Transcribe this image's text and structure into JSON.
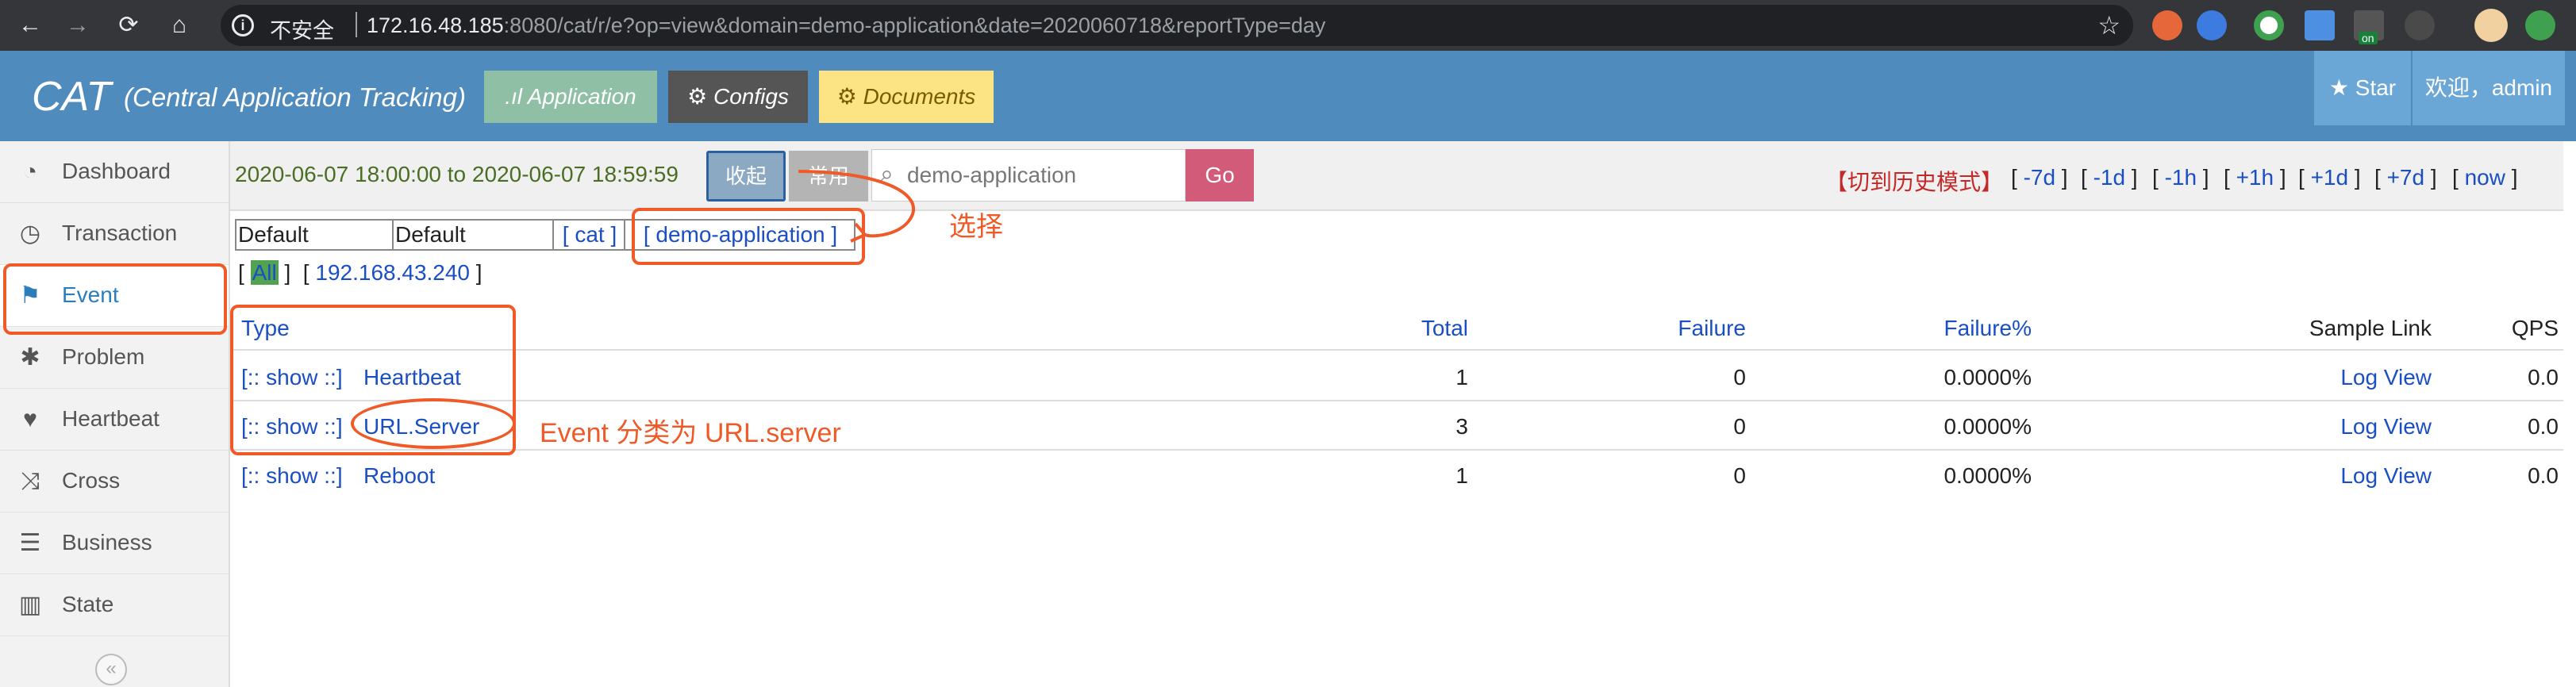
{
  "browser": {
    "insecure_label": "不安全",
    "url_host": "172.16.48.185",
    "url_rest": ":8080/cat/r/e?op=view&domain=demo-application&date=2020060718&reportType=day",
    "extension_badge": "on"
  },
  "header": {
    "brand": "CAT",
    "brand_sub": "(Central Application Tracking)",
    "tabs": [
      {
        "label": "Application"
      },
      {
        "label": "Configs"
      },
      {
        "label": "Documents"
      }
    ],
    "star_label": "Star",
    "welcome": "欢迎，admin"
  },
  "sidebar": {
    "items": [
      {
        "label": "Dashboard",
        "icon": "dashboard-icon"
      },
      {
        "label": "Transaction",
        "icon": "clock-icon"
      },
      {
        "label": "Event",
        "icon": "flag-icon"
      },
      {
        "label": "Problem",
        "icon": "bug-icon"
      },
      {
        "label": "Heartbeat",
        "icon": "heart-icon"
      },
      {
        "label": "Cross",
        "icon": "random-icon"
      },
      {
        "label": "Business",
        "icon": "list-icon"
      },
      {
        "label": "State",
        "icon": "bar-chart-icon"
      }
    ],
    "active": "Event"
  },
  "toolbar": {
    "time_range": "2020-06-07 18:00:00 to 2020-06-07 18:59:59",
    "fold_label": "收起",
    "common_label": "常用",
    "search_value": "demo-application",
    "go_label": "Go",
    "history_label": "【切到历史模式】",
    "quick": [
      "-7d",
      "-1d",
      "-1h",
      "+1h",
      "+1d",
      "+7d",
      "now"
    ]
  },
  "domain_row": {
    "cells": [
      "Default",
      "Default",
      "[ cat ]",
      "[ demo-application ]"
    ]
  },
  "ip_row": {
    "all_label": "All",
    "ip": "192.168.43.240"
  },
  "table": {
    "headers": [
      "Type",
      "Total",
      "Failure",
      "Failure%",
      "Sample Link",
      "QPS"
    ],
    "rows": [
      {
        "show": "[:: show ::]",
        "type": "Heartbeat",
        "total": "1",
        "failure": "0",
        "failure_pct": "0.0000%",
        "link": "Log View",
        "qps": "0.0"
      },
      {
        "show": "[:: show ::]",
        "type": "URL.Server",
        "total": "3",
        "failure": "0",
        "failure_pct": "0.0000%",
        "link": "Log View",
        "qps": "0.0"
      },
      {
        "show": "[:: show ::]",
        "type": "Reboot",
        "total": "1",
        "failure": "0",
        "failure_pct": "0.0000%",
        "link": "Log View",
        "qps": "0.0"
      }
    ]
  },
  "annotations": {
    "select_label": "选择",
    "event_label": "Event 分类为 URL.server",
    "color": "#f05a28"
  }
}
